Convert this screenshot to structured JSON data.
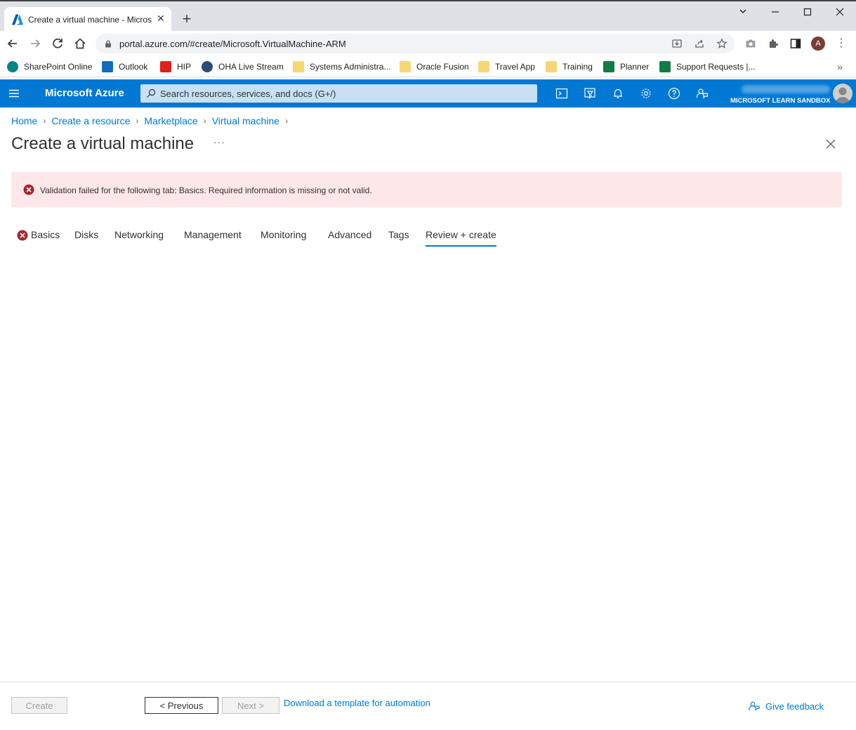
{
  "browser": {
    "tab_title": "Create a virtual machine - Micros",
    "url": "portal.azure.com/#create/Microsoft.VirtualMachine-ARM",
    "profile_initial": "A",
    "bookmarks": [
      {
        "label": "SharePoint Online",
        "icon": "sharepoint-icon",
        "color": "#038387"
      },
      {
        "label": "Outlook",
        "icon": "outlook-icon",
        "color": "#0f6cbd"
      },
      {
        "label": "HIP",
        "icon": "hip-icon",
        "color": "#e0201b"
      },
      {
        "label": "OHA Live Stream",
        "icon": "stream-icon",
        "color": "#2b4b7c"
      },
      {
        "label": "Systems Administra...",
        "icon": "folder-icon",
        "color": "#f7d774"
      },
      {
        "label": "Oracle Fusion",
        "icon": "folder-icon",
        "color": "#f7d774"
      },
      {
        "label": "Travel App",
        "icon": "folder-icon",
        "color": "#f7d774"
      },
      {
        "label": "Training",
        "icon": "folder-icon",
        "color": "#f7d774"
      },
      {
        "label": "Planner",
        "icon": "planner-icon",
        "color": "#107c41"
      },
      {
        "label": "Support Requests |...",
        "icon": "planner-icon",
        "color": "#107c41"
      }
    ]
  },
  "azure": {
    "brand": "Microsoft Azure",
    "search_placeholder": "Search resources, services, and docs (G+/)",
    "directory": "MICROSOFT LEARN SANDBOX",
    "accent": "#0078d4"
  },
  "breadcrumb": [
    "Home",
    "Create a resource",
    "Marketplace",
    "Virtual machine"
  ],
  "page": {
    "title": "Create a virtual machine",
    "more": "···"
  },
  "banner": {
    "message": "Validation failed for the following tab: Basics. Required information is missing or not valid.",
    "color": "#a4262c"
  },
  "tabs": [
    {
      "label": "Basics",
      "error": true
    },
    {
      "label": "Disks"
    },
    {
      "label": "Networking"
    },
    {
      "label": "Management"
    },
    {
      "label": "Monitoring"
    },
    {
      "label": "Advanced"
    },
    {
      "label": "Tags"
    },
    {
      "label": "Review + create",
      "active": true
    }
  ],
  "footer": {
    "create": "Create",
    "previous": "< Previous",
    "next": "Next >",
    "download": "Download a template for automation",
    "feedback": "Give feedback"
  }
}
